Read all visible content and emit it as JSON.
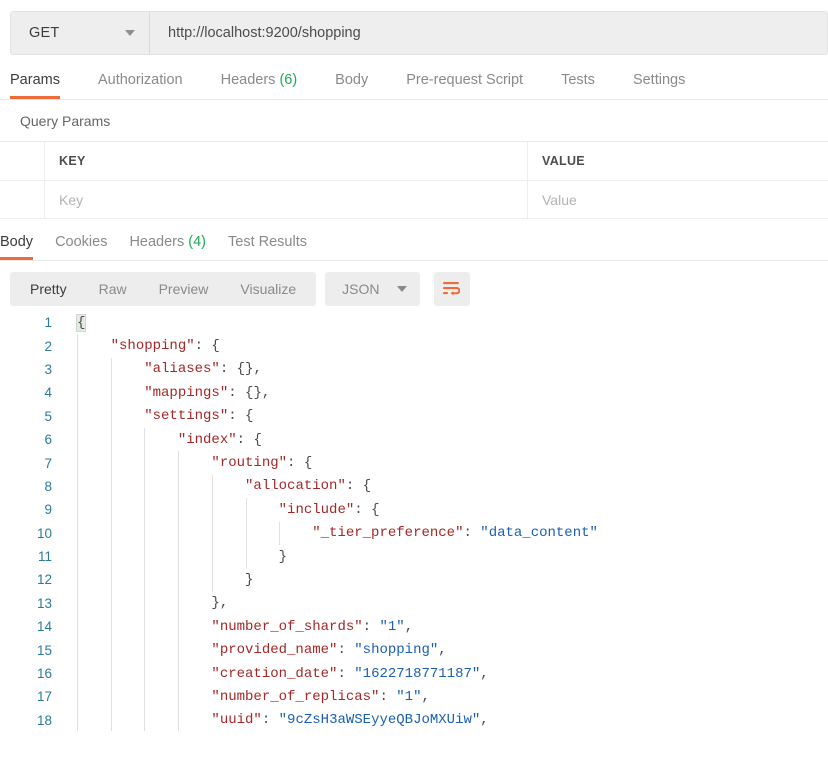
{
  "request": {
    "method": "GET",
    "url": "http://localhost:9200/shopping",
    "method_caret_icon": "chevron-down-icon",
    "tabs": [
      {
        "label": "Params",
        "count": "",
        "active": true
      },
      {
        "label": "Authorization",
        "count": "",
        "active": false
      },
      {
        "label": "Headers",
        "count": "(6)",
        "active": false
      },
      {
        "label": "Body",
        "count": "",
        "active": false
      },
      {
        "label": "Pre-request Script",
        "count": "",
        "active": false
      },
      {
        "label": "Tests",
        "count": "",
        "active": false
      },
      {
        "label": "Settings",
        "count": "",
        "active": false
      }
    ]
  },
  "query_params": {
    "section_title": "Query Params",
    "columns": [
      "KEY",
      "VALUE"
    ],
    "rows": [
      {
        "key_placeholder": "Key",
        "value_placeholder": "Value"
      }
    ]
  },
  "response": {
    "tabs": [
      {
        "label": "Body",
        "count": "",
        "active": true
      },
      {
        "label": "Cookies",
        "count": "",
        "active": false
      },
      {
        "label": "Headers",
        "count": "(4)",
        "active": false
      },
      {
        "label": "Test Results",
        "count": "",
        "active": false
      }
    ],
    "view_modes": [
      {
        "label": "Pretty",
        "active": true
      },
      {
        "label": "Raw",
        "active": false
      },
      {
        "label": "Preview",
        "active": false
      },
      {
        "label": "Visualize",
        "active": false
      }
    ],
    "format": "JSON",
    "format_caret_icon": "chevron-down-icon",
    "wrap_icon": "word-wrap-icon"
  },
  "colors": {
    "accent_orange": "#ef6c3a",
    "count_green": "#1cab54",
    "json_key": "#a52727",
    "json_string": "#1a5fb4",
    "line_number": "#2b7a9b",
    "toolbar_bg": "#ededed"
  },
  "code": {
    "lines": [
      {
        "n": "1",
        "indent": 0,
        "tokens": [
          {
            "t": "{",
            "c": "hl"
          }
        ]
      },
      {
        "n": "2",
        "indent": 1,
        "tokens": [
          {
            "t": "\"shopping\"",
            "c": "k"
          },
          {
            "t": ": {",
            "c": "p"
          }
        ]
      },
      {
        "n": "3",
        "indent": 2,
        "tokens": [
          {
            "t": "\"aliases\"",
            "c": "k"
          },
          {
            "t": ": {},",
            "c": "p"
          }
        ]
      },
      {
        "n": "4",
        "indent": 2,
        "tokens": [
          {
            "t": "\"mappings\"",
            "c": "k"
          },
          {
            "t": ": {},",
            "c": "p"
          }
        ]
      },
      {
        "n": "5",
        "indent": 2,
        "tokens": [
          {
            "t": "\"settings\"",
            "c": "k"
          },
          {
            "t": ": {",
            "c": "p"
          }
        ]
      },
      {
        "n": "6",
        "indent": 3,
        "tokens": [
          {
            "t": "\"index\"",
            "c": "k"
          },
          {
            "t": ": {",
            "c": "p"
          }
        ]
      },
      {
        "n": "7",
        "indent": 4,
        "tokens": [
          {
            "t": "\"routing\"",
            "c": "k"
          },
          {
            "t": ": {",
            "c": "p"
          }
        ]
      },
      {
        "n": "8",
        "indent": 5,
        "tokens": [
          {
            "t": "\"allocation\"",
            "c": "k"
          },
          {
            "t": ": {",
            "c": "p"
          }
        ]
      },
      {
        "n": "9",
        "indent": 6,
        "tokens": [
          {
            "t": "\"include\"",
            "c": "k"
          },
          {
            "t": ": {",
            "c": "p"
          }
        ]
      },
      {
        "n": "10",
        "indent": 7,
        "tokens": [
          {
            "t": "\"_tier_preference\"",
            "c": "k"
          },
          {
            "t": ": ",
            "c": "p"
          },
          {
            "t": "\"data_content\"",
            "c": "s"
          }
        ]
      },
      {
        "n": "11",
        "indent": 6,
        "tokens": [
          {
            "t": "}",
            "c": "p"
          }
        ]
      },
      {
        "n": "12",
        "indent": 5,
        "tokens": [
          {
            "t": "}",
            "c": "p"
          }
        ]
      },
      {
        "n": "13",
        "indent": 4,
        "tokens": [
          {
            "t": "},",
            "c": "p"
          }
        ]
      },
      {
        "n": "14",
        "indent": 4,
        "tokens": [
          {
            "t": "\"number_of_shards\"",
            "c": "k"
          },
          {
            "t": ": ",
            "c": "p"
          },
          {
            "t": "\"1\"",
            "c": "s"
          },
          {
            "t": ",",
            "c": "p"
          }
        ]
      },
      {
        "n": "15",
        "indent": 4,
        "tokens": [
          {
            "t": "\"provided_name\"",
            "c": "k"
          },
          {
            "t": ": ",
            "c": "p"
          },
          {
            "t": "\"shopping\"",
            "c": "s"
          },
          {
            "t": ",",
            "c": "p"
          }
        ]
      },
      {
        "n": "16",
        "indent": 4,
        "tokens": [
          {
            "t": "\"creation_date\"",
            "c": "k"
          },
          {
            "t": ": ",
            "c": "p"
          },
          {
            "t": "\"1622718771187\"",
            "c": "s"
          },
          {
            "t": ",",
            "c": "p"
          }
        ]
      },
      {
        "n": "17",
        "indent": 4,
        "tokens": [
          {
            "t": "\"number_of_replicas\"",
            "c": "k"
          },
          {
            "t": ": ",
            "c": "p"
          },
          {
            "t": "\"1\"",
            "c": "s"
          },
          {
            "t": ",",
            "c": "p"
          }
        ]
      },
      {
        "n": "18",
        "indent": 4,
        "tokens": [
          {
            "t": "\"uuid\"",
            "c": "k"
          },
          {
            "t": ": ",
            "c": "p"
          },
          {
            "t": "\"9cZsH3aWSEyyeQBJoMXUiw\"",
            "c": "s"
          },
          {
            "t": ",",
            "c": "p"
          }
        ]
      }
    ]
  }
}
